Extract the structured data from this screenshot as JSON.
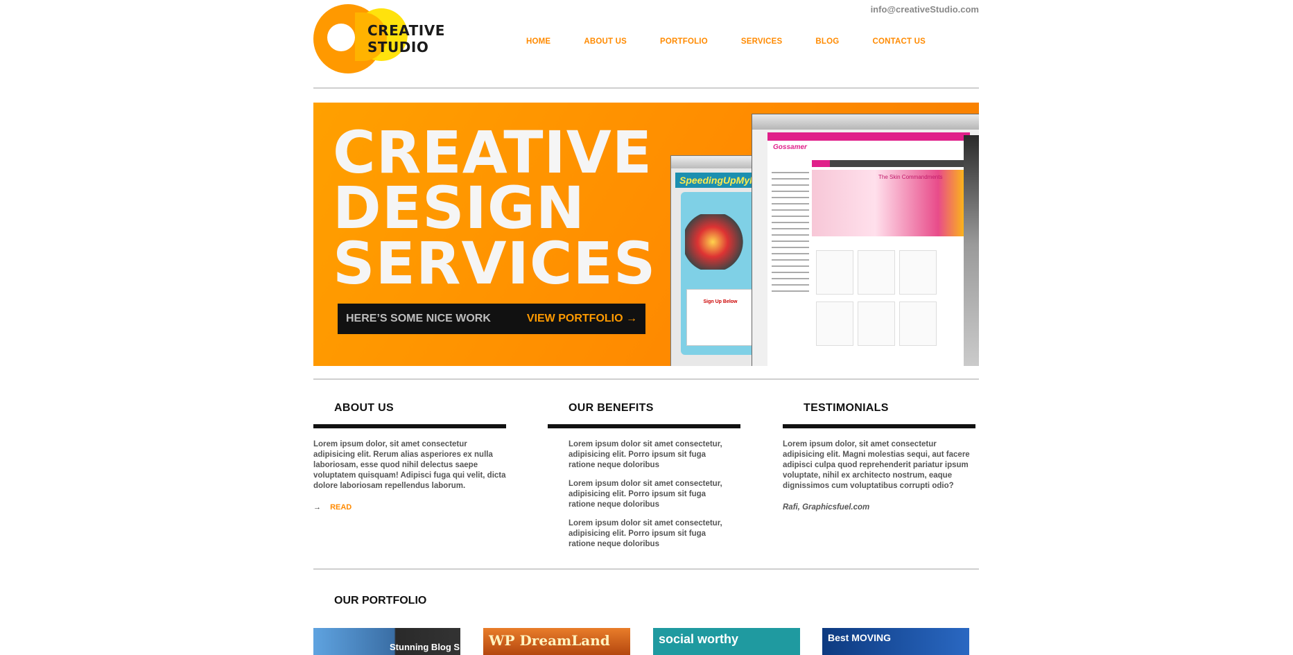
{
  "header": {
    "logo_line1": "CREATIVE",
    "logo_line2": "STUDIO",
    "email": "info@creativeStudio.com",
    "nav": [
      "HOME",
      "ABOUT US",
      "PORTFOLIO",
      "SERVICES",
      "BLOG",
      "CONTACT US"
    ]
  },
  "hero": {
    "title_lines": [
      "CREATIVE",
      "DESIGN",
      "SERVICES"
    ],
    "lead_text": "HERE’S SOME NICE WORK",
    "cta_label": "VIEW PORTFOLIO →",
    "mock_back_brand": "SpeedingUpMyPC",
    "mock_back_signup": "Sign Up Below",
    "mock_front_brand": "Gossamer",
    "mock_front_banner": "The Skin Commandments"
  },
  "about": {
    "title": "ABOUT US",
    "text": "Lorem ipsum dolor, sit amet consectetur adipisicing elit. Rerum alias asperiores ex nulla laboriosam, esse quod nihil delectus saepe voluptatem quisquam! Adipisci fuga qui velit, dicta dolore laboriosam repellendus laborum.",
    "read_arrow": "→",
    "read_label": "READ"
  },
  "benefits": {
    "title": "OUR BENEFITS",
    "items": [
      "Lorem ipsum dolor sit amet consectetur, adipisicing elit. Porro ipsum sit fuga ratione neque doloribus",
      "Lorem ipsum dolor sit amet consectetur, adipisicing elit. Porro ipsum sit fuga ratione neque doloribus",
      "Lorem ipsum dolor sit amet consectetur, adipisicing elit. Porro ipsum sit fuga ratione neque doloribus"
    ]
  },
  "testimonials": {
    "title": "TESTIMONIALS",
    "text": "Lorem ipsum dolor, sit amet consectetur adipisicing elit. Magni molestias sequi, aut facere adipisci culpa quod reprehenderit pariatur ipsum voluptate, nihil ex architecto nostrum, eaque dignissimos cum voluptatibus corrupti odio?",
    "author": "Rafi, Graphicsfuel.com"
  },
  "portfolio": {
    "title": "OUR PORTFOLIO",
    "thumbs": [
      {
        "label": "Stunning Blog S",
        "bg": "#3a6ea5"
      },
      {
        "label": "WP DreamLand",
        "bg": "#c9561a"
      },
      {
        "label": "social worthy",
        "bg": "#1f9aa0"
      },
      {
        "label": "Best MOVING",
        "bg": "#1c4fa0"
      }
    ]
  },
  "colors": {
    "accent": "#ff8a00",
    "dark": "#111111",
    "text": "#555555"
  }
}
